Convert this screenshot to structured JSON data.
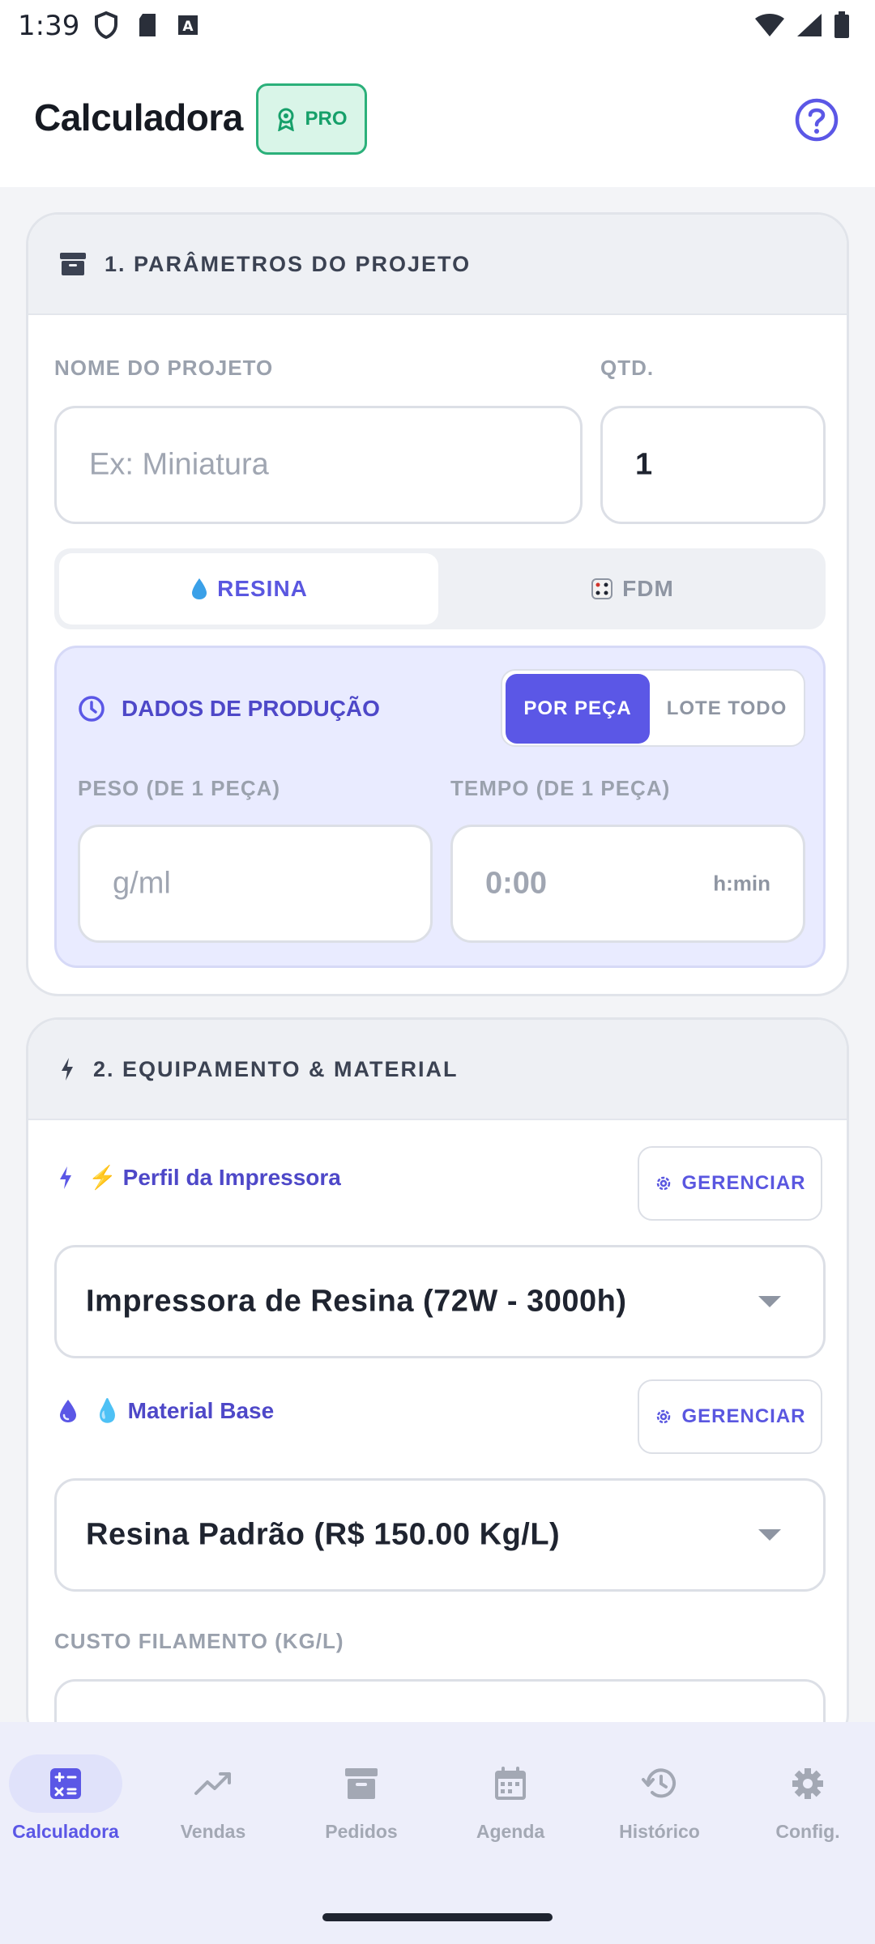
{
  "status_bar": {
    "time": "1:39"
  },
  "header": {
    "title": "Calculadora",
    "badge": "PRO"
  },
  "section1": {
    "title": "1. PARÂMETROS DO PROJETO",
    "project_name_label": "NOME DO PROJETO",
    "project_name_placeholder": "Ex: Miniatura",
    "qty_label": "QTD.",
    "qty_value": "1",
    "tabs": [
      {
        "label": "RESINA",
        "icon": "droplet-icon",
        "active": true
      },
      {
        "label": "FDM",
        "icon": "dice-icon",
        "active": false
      }
    ],
    "production": {
      "title": "DADOS DE PRODUÇÃO",
      "toggle_on": "POR PEÇA",
      "toggle_off": "LOTE TODO",
      "weight_label": "PESO (DE 1 PEÇA)",
      "weight_placeholder": "g/ml",
      "time_label": "TEMPO (DE 1 PEÇA)",
      "time_placeholder": "0:00",
      "time_suffix": "h:min"
    }
  },
  "section2": {
    "title": "2. EQUIPAMENTO & MATERIAL",
    "printer_label": "⚡ Perfil da Impressora",
    "printer_manage": "GERENCIAR",
    "printer_value": "Impressora de Resina (72W - 3000h)",
    "material_label": "💧 Material Base",
    "material_manage": "GERENCIAR",
    "material_value": "Resina Padrão (R$ 150.00 Kg/L)",
    "filament_cost_label": "CUSTO FILAMENTO (KG/L)"
  },
  "bottom_nav": [
    {
      "label": "Calculadora",
      "icon": "calculator-icon",
      "active": true
    },
    {
      "label": "Vendas",
      "icon": "trending-up-icon",
      "active": false
    },
    {
      "label": "Pedidos",
      "icon": "archive-icon",
      "active": false
    },
    {
      "label": "Agenda",
      "icon": "calendar-icon",
      "active": false
    },
    {
      "label": "Histórico",
      "icon": "history-icon",
      "active": false
    },
    {
      "label": "Config.",
      "icon": "gear-icon",
      "active": false
    }
  ],
  "colors": {
    "accent": "#5b57e6",
    "accent_text": "#4e48c8",
    "pro_green": "#16a06a",
    "pro_bg": "#d9f5e8",
    "panel_bg": "#e9ebff"
  }
}
